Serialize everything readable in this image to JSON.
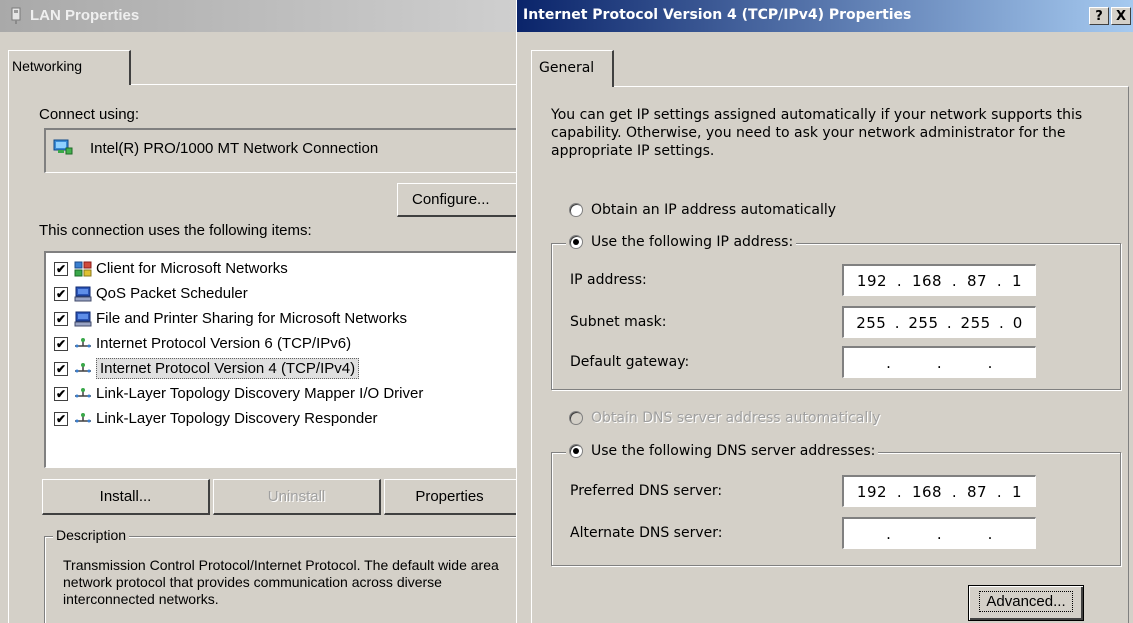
{
  "lan": {
    "title": "LAN Properties",
    "tab_label": "Networking",
    "connect_using_label": "Connect using:",
    "adapter_name": "Intel(R) PRO/1000 MT Network Connection",
    "configure_button": "Configure...",
    "items_label": "This connection uses the following items:",
    "items": [
      {
        "label": "Client for Microsoft Networks",
        "checked": true,
        "icon": "network-client-icon"
      },
      {
        "label": "QoS Packet Scheduler",
        "checked": true,
        "icon": "computer-icon"
      },
      {
        "label": "File and Printer Sharing for Microsoft Networks",
        "checked": true,
        "icon": "computer-icon"
      },
      {
        "label": "Internet Protocol Version 6 (TCP/IPv6)",
        "checked": true,
        "icon": "protocol-icon"
      },
      {
        "label": "Internet Protocol Version 4 (TCP/IPv4)",
        "checked": true,
        "icon": "protocol-icon",
        "selected": true
      },
      {
        "label": "Link-Layer Topology Discovery Mapper I/O Driver",
        "checked": true,
        "icon": "protocol-icon"
      },
      {
        "label": "Link-Layer Topology Discovery Responder",
        "checked": true,
        "icon": "protocol-icon"
      }
    ],
    "install_button": "Install...",
    "uninstall_button": "Uninstall",
    "properties_button": "Properties",
    "description_label": "Description",
    "description_text": "Transmission Control Protocol/Internet Protocol. The default wide area network protocol that provides communication across diverse interconnected networks."
  },
  "ipv4": {
    "title": "Internet Protocol Version 4 (TCP/IPv4) Properties",
    "help_button": "?",
    "close_button": "X",
    "tab_label": "General",
    "intro_text": "You can get IP settings assigned automatically if your network supports this capability. Otherwise, you need to ask your network administrator for the appropriate IP settings.",
    "obtain_ip_auto": "Obtain an IP address automatically",
    "use_following_ip": "Use the following IP address:",
    "ip_address_label": "IP address:",
    "ip_address": [
      "192",
      "168",
      "87",
      "1"
    ],
    "subnet_label": "Subnet mask:",
    "subnet_mask": [
      "255",
      "255",
      "255",
      "0"
    ],
    "gateway_label": "Default gateway:",
    "gateway": [
      "",
      "",
      "",
      ""
    ],
    "obtain_dns_auto": "Obtain DNS server address automatically",
    "use_following_dns": "Use the following DNS server addresses:",
    "preferred_dns_label": "Preferred DNS server:",
    "preferred_dns": [
      "192",
      "168",
      "87",
      "1"
    ],
    "alternate_dns_label": "Alternate DNS server:",
    "alternate_dns": [
      "",
      "",
      "",
      ""
    ],
    "advanced_button": "Advanced..."
  },
  "colors": {
    "active_title_start": "#0a246a",
    "active_title_end": "#a6caf0",
    "inactive_title": "#a9a9a9",
    "face": "#d4d0c8"
  }
}
